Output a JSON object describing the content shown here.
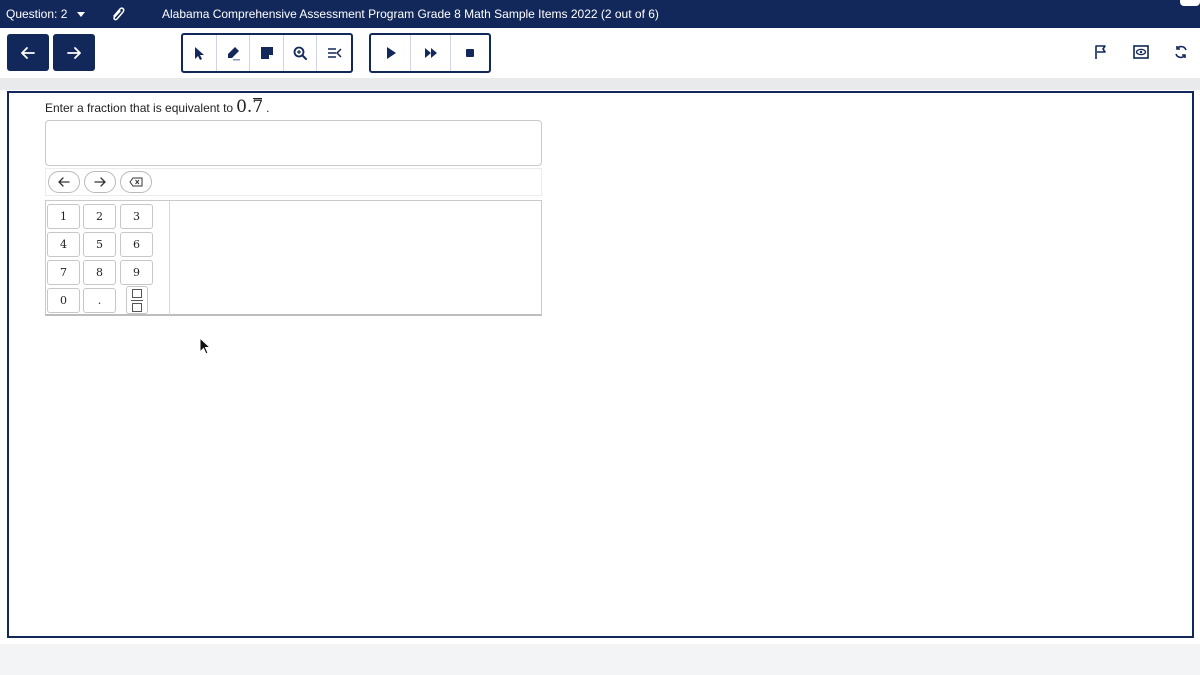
{
  "header": {
    "question_label": "Question: 2",
    "title": "Alabama Comprehensive Assessment Program Grade 8 Math Sample Items 2022 (2 out of 6)"
  },
  "toolbar": {
    "tools": [
      "pointer-icon",
      "highlighter-icon",
      "sticky-note-icon",
      "zoom-icon",
      "line-reader-icon"
    ],
    "playback": [
      "play-icon",
      "fast-forward-icon",
      "stop-icon"
    ],
    "right": [
      "flag-icon",
      "eye-icon",
      "refresh-icon"
    ]
  },
  "question": {
    "prompt_text": "Enter a fraction that is equivalent to",
    "math_whole": "0.",
    "math_repeating": "7",
    "prompt_end": ".",
    "answer_value": ""
  },
  "keypad": {
    "nav_keys": [
      "arrow-left-icon",
      "arrow-right-icon",
      "backspace-icon"
    ],
    "digits": [
      "1",
      "2",
      "3",
      "4",
      "5",
      "6",
      "7",
      "8",
      "9",
      "0",
      "."
    ],
    "fraction_key": "fraction-icon"
  },
  "colors": {
    "navy": "#13285a",
    "border_gray": "#c9c9c9"
  }
}
